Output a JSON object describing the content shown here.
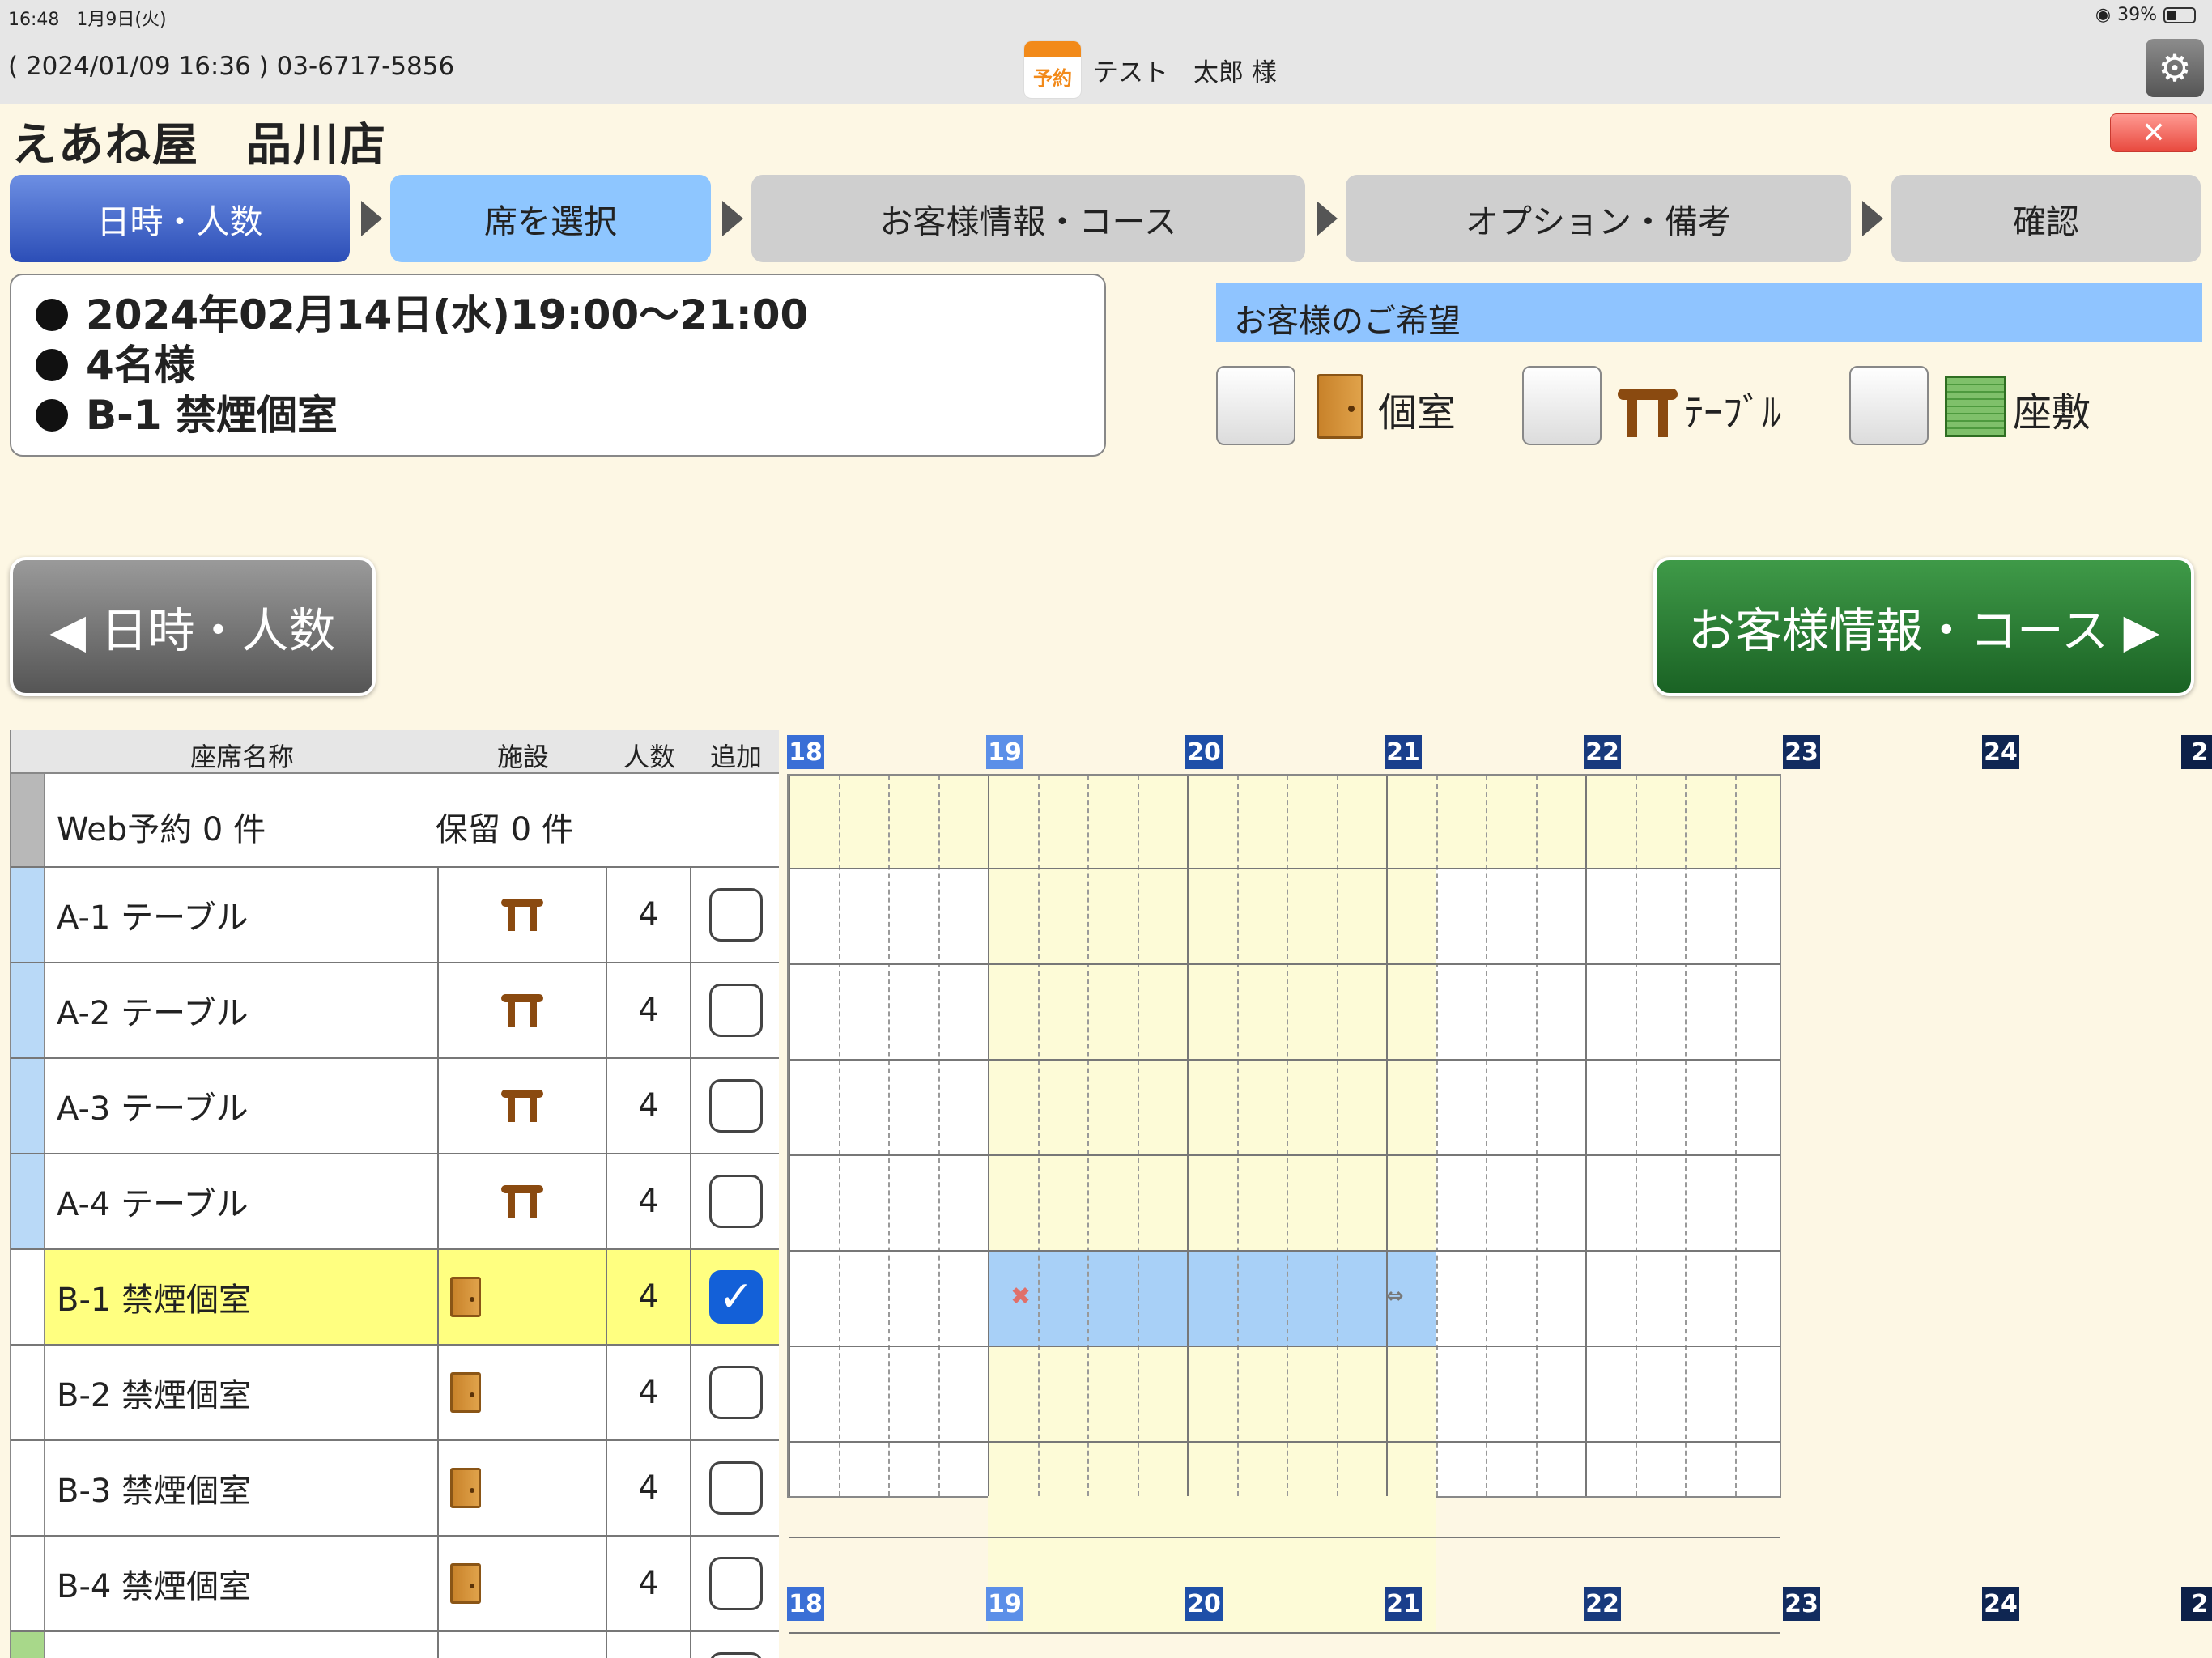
{
  "status_bar": {
    "time": "16:48",
    "date": "1月9日(火)",
    "battery": "39%"
  },
  "top_bar": {
    "contact": "( 2024/01/09 16:36 )  03-6717-5856",
    "badge": "予約",
    "user": "テスト　太郎 様"
  },
  "shop_title": "えあね屋　品川店",
  "steps": [
    "日時・人数",
    "席を選択",
    "お客様情報・コース",
    "オプション・備考",
    "確認"
  ],
  "summary": {
    "datetime": "2024年02月14日(水)19:00〜21:00",
    "people": "4名様",
    "seat": "B-1  禁煙個室"
  },
  "preferences": {
    "header": "お客様のご希望",
    "private_room": "個室",
    "table": "ﾃｰﾌﾞﾙ",
    "tatami": "座敷"
  },
  "nav": {
    "back": "◀ 日時・人数",
    "next": "お客様情報・コース ▶"
  },
  "seat_table": {
    "headers": {
      "name": "座席名称",
      "facility": "施設",
      "count": "人数",
      "add": "追加"
    },
    "web_reservations": "Web予約  0 件",
    "held": "保留  0 件",
    "rows": [
      {
        "name": "A-1 テーブル",
        "facility": "table",
        "count": "4",
        "checked": false
      },
      {
        "name": "A-2 テーブル",
        "facility": "table",
        "count": "4",
        "checked": false
      },
      {
        "name": "A-3 テーブル",
        "facility": "table",
        "count": "4",
        "checked": false
      },
      {
        "name": "A-4 テーブル",
        "facility": "table",
        "count": "4",
        "checked": false
      },
      {
        "name": "B-1 禁煙個室",
        "facility": "private-room",
        "count": "4",
        "checked": true
      },
      {
        "name": "B-2 禁煙個室",
        "facility": "private-room",
        "count": "4",
        "checked": false
      },
      {
        "name": "B-3 禁煙個室",
        "facility": "private-room",
        "count": "4",
        "checked": false
      },
      {
        "name": "B-4 禁煙個室",
        "facility": "private-room",
        "count": "4",
        "checked": false
      }
    ]
  },
  "timeline": {
    "hours": [
      "18",
      "19",
      "20",
      "21",
      "22",
      "23",
      "24",
      "2"
    ],
    "hour_colors": [
      "#3a6fd6",
      "#5b8fe8",
      "#1e4fa8",
      "#1a3f8c",
      "#183a7d",
      "#122c60",
      "#0f2652",
      "#0d2048"
    ],
    "requested_range": [
      "19:00",
      "21:15"
    ],
    "booking": {
      "seat": "B-1 禁煙個室",
      "start": "19:00",
      "end": "21:15"
    }
  },
  "colors": {
    "selected_step": "#8ec6ff",
    "next_button": "#1a6224",
    "booking": "#a8d0f7",
    "selected_row": "#ffff80"
  }
}
